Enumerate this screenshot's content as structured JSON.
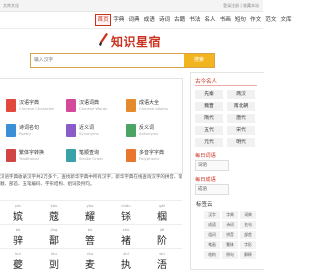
{
  "topbar": {
    "left": "文库文化",
    "right": "登录注册 | 收藏本站"
  },
  "nav": [
    "首页",
    "字典",
    "词典",
    "成语",
    "诗词",
    "古籍",
    "书法",
    "名人",
    "书画",
    "短句",
    "作文",
    "范文",
    "文库"
  ],
  "logo": {
    "title": "知识星宿"
  },
  "search": {
    "placeholder": "输入汉字",
    "button": "搜索"
  },
  "tools": [
    {
      "name": "汉语字典",
      "sub": "Chinese Character",
      "color": "#e2493d"
    },
    {
      "name": "汉语词典",
      "sub": "Chinese Words",
      "color": "#d44a9b"
    },
    {
      "name": "成语大全",
      "sub": "Chinese Idioms",
      "color": "#e68a2e"
    },
    {
      "name": "诗词名句",
      "sub": "Poetry",
      "color": "#3b8fd6"
    },
    {
      "name": "近义词",
      "sub": "Synonyms",
      "color": "#8a5cc9"
    },
    {
      "name": "反义词",
      "sub": "Antonyms",
      "color": "#4aa564"
    },
    {
      "name": "繁体字转换",
      "sub": "Traditional",
      "color": "#d14545"
    },
    {
      "name": "笔顺查询",
      "sub": "Stroke Order",
      "color": "#3aa1a9"
    },
    {
      "name": "多音字字典",
      "sub": "Polyphonic",
      "color": "#e8762e"
    }
  ],
  "intro": [
    "汉语字典收录汉字共2万多个，查找新华字典中所有汉字，新华字典在线查询汉字的拼音、笔",
    "顺、部首、五笔编码、字形结构、组词及例句。"
  ],
  "chars": [
    {
      "py": "pín",
      "ch": "嫔"
    },
    {
      "py": "kōu",
      "ch": "蔻"
    },
    {
      "py": "yào",
      "ch": "耀"
    },
    {
      "py": "chóu",
      "ch": "铩"
    },
    {
      "py": "gāi",
      "ch": "椢"
    },
    {
      "py": "bó",
      "ch": "骍"
    },
    {
      "py": "jīng",
      "ch": "鄑"
    },
    {
      "py": "bù",
      "ch": "箁"
    },
    {
      "py": "zhǔ",
      "ch": "褚"
    },
    {
      "py": "jiē",
      "ch": "阶"
    },
    {
      "py": "kuí",
      "ch": "夔"
    },
    {
      "py": "lóu",
      "ch": "剅"
    },
    {
      "py": "ròu",
      "ch": "麦"
    },
    {
      "py": "zhí",
      "ch": "执"
    },
    {
      "py": "wú",
      "ch": "浯"
    }
  ],
  "side": {
    "dynasty_title": "古今名人",
    "dynasties": [
      "先秦",
      "两汉",
      "魏晋",
      "南北朝",
      "隋代",
      "唐代",
      "五代",
      "宋代",
      "元代",
      "明代"
    ],
    "daily_word": "每日词语",
    "daily_word_img": "词语",
    "daily_idiom": "每日成语",
    "daily_idiom_img": "成语"
  },
  "clouds": {
    "title": "标签云",
    "tags": [
      "汉字",
      "字典",
      "词典",
      "成语",
      "诗词",
      "名句",
      "组词",
      "拼音",
      "部首",
      "笔画",
      "繁体",
      "字形",
      "结构",
      "例句",
      "解释"
    ]
  }
}
